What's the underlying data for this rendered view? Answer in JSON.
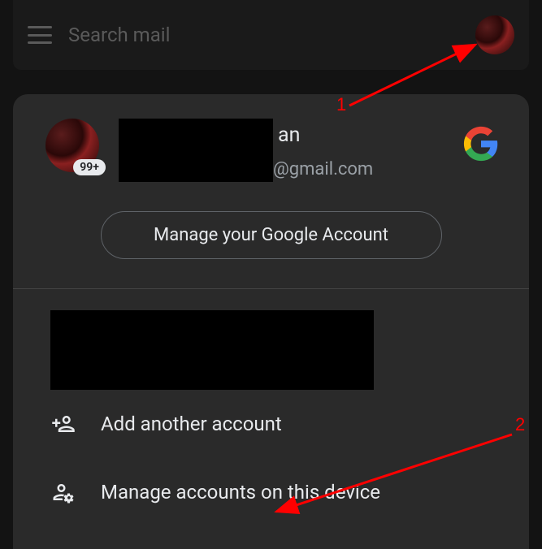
{
  "search": {
    "placeholder": "Search mail"
  },
  "account": {
    "name_suffix": "an",
    "email_suffix": "@gmail.com",
    "badge": "99+",
    "manage_button": "Manage your Google Account"
  },
  "menu": {
    "add_account": "Add another account",
    "manage_device": "Manage accounts on this device"
  },
  "annotations": {
    "label1": "1",
    "label2": "2"
  }
}
